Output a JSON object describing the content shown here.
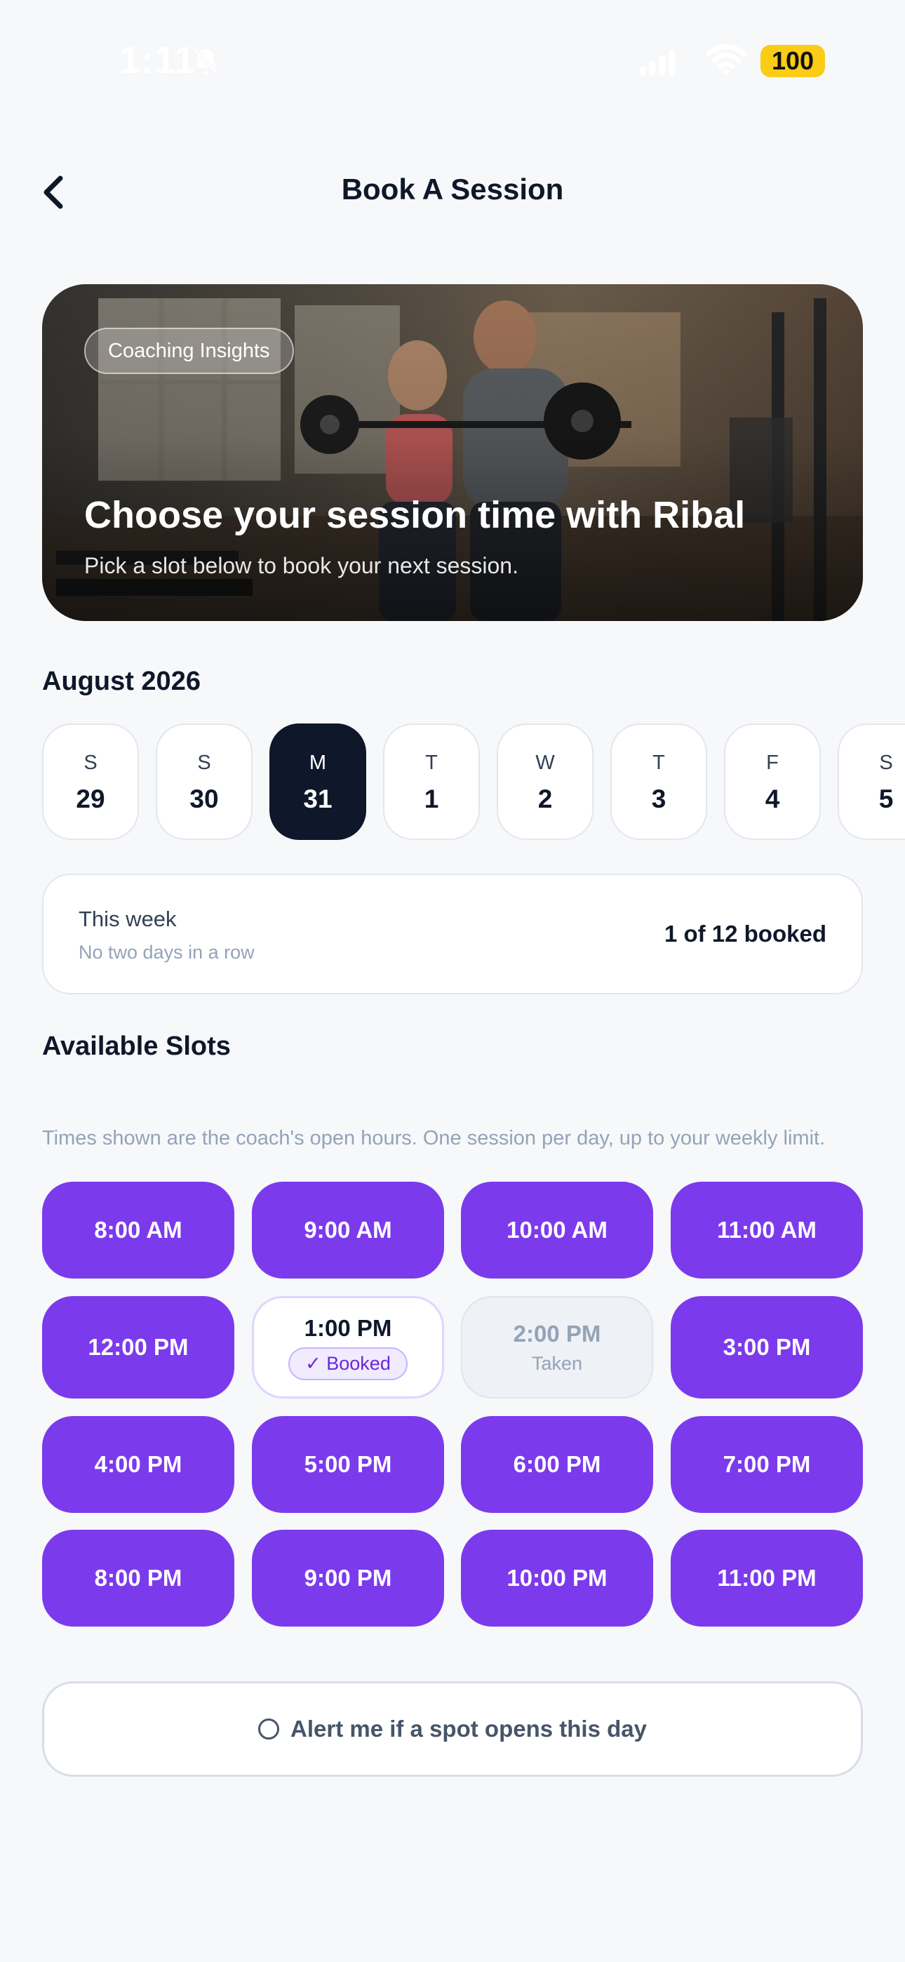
{
  "status_bar": {
    "time": "1:11",
    "battery": "100"
  },
  "header": {
    "title": "Book A Session"
  },
  "hero": {
    "badge": "Coaching Insights",
    "title": "Choose your session time with Ribal",
    "subtitle": "Pick a slot below to book your next session."
  },
  "calendar": {
    "month": "August 2026",
    "days": [
      {
        "dow": "S",
        "num": "29",
        "selected": false
      },
      {
        "dow": "S",
        "num": "30",
        "selected": false
      },
      {
        "dow": "M",
        "num": "31",
        "selected": true
      },
      {
        "dow": "T",
        "num": "1",
        "selected": false
      },
      {
        "dow": "W",
        "num": "2",
        "selected": false
      },
      {
        "dow": "T",
        "num": "3",
        "selected": false
      },
      {
        "dow": "F",
        "num": "4",
        "selected": false
      },
      {
        "dow": "S",
        "num": "5",
        "selected": false
      }
    ]
  },
  "week_summary": {
    "title": "This week",
    "subtitle": "No two days in a row",
    "count": "1 of 12 booked"
  },
  "slots": {
    "title": "Available Slots",
    "note": "Times shown are the coach's open hours. One session per day, up to your weekly limit.",
    "items": [
      {
        "time": "8:00 AM",
        "state": "available"
      },
      {
        "time": "9:00 AM",
        "state": "available"
      },
      {
        "time": "10:00 AM",
        "state": "available"
      },
      {
        "time": "11:00 AM",
        "state": "available"
      },
      {
        "time": "12:00 PM",
        "state": "available"
      },
      {
        "time": "1:00 PM",
        "state": "booked",
        "sub": "✓ Booked"
      },
      {
        "time": "2:00 PM",
        "state": "taken",
        "sub": "Taken"
      },
      {
        "time": "3:00 PM",
        "state": "available"
      },
      {
        "time": "4:00 PM",
        "state": "available"
      },
      {
        "time": "5:00 PM",
        "state": "available"
      },
      {
        "time": "6:00 PM",
        "state": "available"
      },
      {
        "time": "7:00 PM",
        "state": "available"
      },
      {
        "time": "8:00 PM",
        "state": "available"
      },
      {
        "time": "9:00 PM",
        "state": "available"
      },
      {
        "time": "10:00 PM",
        "state": "available"
      },
      {
        "time": "11:00 PM",
        "state": "available"
      }
    ]
  },
  "alert": {
    "label": "Alert me if a spot opens this day",
    "checked": false
  },
  "colors": {
    "accent": "#7c3aed",
    "selected_day": "#0f172a",
    "battery": "#facc15",
    "background": "#f7f8fa"
  },
  "icons": [
    "bell-off-icon",
    "signal-icon",
    "wifi-icon",
    "battery-icon",
    "back-chevron-icon",
    "checkmark-icon",
    "radio-icon"
  ]
}
